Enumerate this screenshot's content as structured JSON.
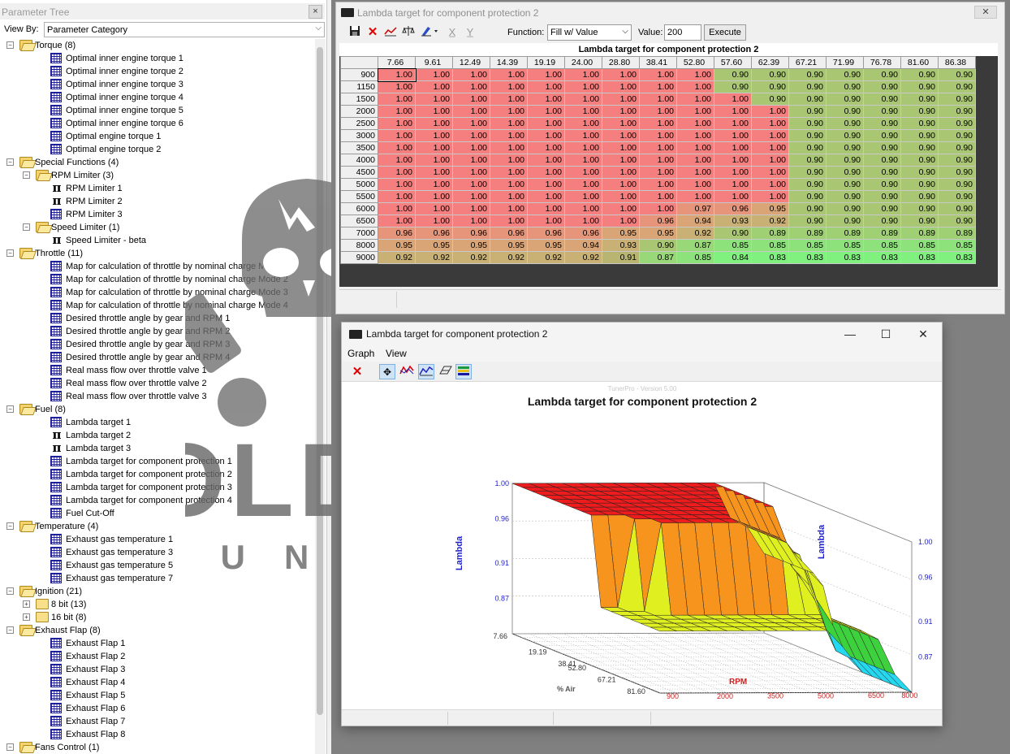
{
  "tree": {
    "title": "Parameter Tree",
    "close_icon": "×",
    "view_by_label": "View By:",
    "view_by_value": "Parameter Category",
    "rows": [
      {
        "kind": "folder-open",
        "level": 0,
        "label": "Torque (8)",
        "expander": "−"
      },
      {
        "kind": "table",
        "level": 1,
        "label": "Optimal inner engine torque 1"
      },
      {
        "kind": "table",
        "level": 1,
        "label": "Optimal inner engine torque 2"
      },
      {
        "kind": "table",
        "level": 1,
        "label": "Optimal inner engine torque 3"
      },
      {
        "kind": "table",
        "level": 1,
        "label": "Optimal inner engine torque 4"
      },
      {
        "kind": "table",
        "level": 1,
        "label": "Optimal inner engine torque 5"
      },
      {
        "kind": "table",
        "level": 1,
        "label": "Optimal inner engine torque 6"
      },
      {
        "kind": "table",
        "level": 1,
        "label": "Optimal engine torque 1"
      },
      {
        "kind": "table",
        "level": 1,
        "label": "Optimal engine torque 2"
      },
      {
        "kind": "folder-open",
        "level": 0,
        "label": "Special Functions (4)",
        "expander": "−"
      },
      {
        "kind": "folder-open",
        "level": 1,
        "label": "RPM Limiter (3)",
        "expander": "−"
      },
      {
        "kind": "pi",
        "level": 2,
        "label": "RPM Limiter 1"
      },
      {
        "kind": "pi",
        "level": 2,
        "label": "RPM Limiter 2"
      },
      {
        "kind": "table",
        "level": 2,
        "label": "RPM Limiter 3"
      },
      {
        "kind": "folder-open",
        "level": 1,
        "label": "Speed Limiter (1)",
        "expander": "−"
      },
      {
        "kind": "pi",
        "level": 2,
        "label": "Speed Limiter - beta"
      },
      {
        "kind": "folder-open",
        "level": 0,
        "label": "Throttle (11)",
        "expander": "−"
      },
      {
        "kind": "table",
        "level": 1,
        "label": "Map for calculation of throttle by nominal charge Mode 1"
      },
      {
        "kind": "table",
        "level": 1,
        "label": "Map for calculation of throttle by nominal charge Mode 2"
      },
      {
        "kind": "table",
        "level": 1,
        "label": "Map for calculation of throttle by nominal charge Mode 3"
      },
      {
        "kind": "table",
        "level": 1,
        "label": "Map for calculation of throttle by nominal charge Mode 4"
      },
      {
        "kind": "table",
        "level": 1,
        "label": "Desired throttle angle by gear and RPM 1"
      },
      {
        "kind": "table",
        "level": 1,
        "label": "Desired throttle angle by gear and RPM 2"
      },
      {
        "kind": "table",
        "level": 1,
        "label": "Desired throttle angle by gear and RPM 3"
      },
      {
        "kind": "table",
        "level": 1,
        "label": "Desired throttle angle by gear and RPM 4"
      },
      {
        "kind": "table",
        "level": 1,
        "label": "Real mass flow over throttle valve 1"
      },
      {
        "kind": "table",
        "level": 1,
        "label": "Real mass flow over throttle valve 2"
      },
      {
        "kind": "table",
        "level": 1,
        "label": "Real mass flow over throttle valve 3"
      },
      {
        "kind": "folder-open",
        "level": 0,
        "label": "Fuel (8)",
        "expander": "−"
      },
      {
        "kind": "table",
        "level": 1,
        "label": "Lambda target 1"
      },
      {
        "kind": "pi",
        "level": 1,
        "label": "Lambda target 2"
      },
      {
        "kind": "pi",
        "level": 1,
        "label": "Lambda target 3"
      },
      {
        "kind": "table",
        "level": 1,
        "label": "Lambda target for component protection 1"
      },
      {
        "kind": "table",
        "level": 1,
        "label": "Lambda target for component protection 2"
      },
      {
        "kind": "table",
        "level": 1,
        "label": "Lambda target for component protection 3"
      },
      {
        "kind": "table",
        "level": 1,
        "label": "Lambda target for component protection 4"
      },
      {
        "kind": "table",
        "level": 1,
        "label": "Fuel Cut-Off"
      },
      {
        "kind": "folder-open",
        "level": 0,
        "label": "Temperature (4)",
        "expander": "−"
      },
      {
        "kind": "table",
        "level": 1,
        "label": "Exhaust gas temperature 1"
      },
      {
        "kind": "table",
        "level": 1,
        "label": "Exhaust gas temperature 3"
      },
      {
        "kind": "table",
        "level": 1,
        "label": "Exhaust gas temperature 5"
      },
      {
        "kind": "table",
        "level": 1,
        "label": "Exhaust gas temperature 7"
      },
      {
        "kind": "folder-open",
        "level": 0,
        "label": "Ignition (21)",
        "expander": "−"
      },
      {
        "kind": "folder",
        "level": 1,
        "label": "8 bit (13)",
        "expander": "+"
      },
      {
        "kind": "folder",
        "level": 1,
        "label": "16 bit (8)",
        "expander": "+"
      },
      {
        "kind": "folder-open",
        "level": 0,
        "label": "Exhaust Flap (8)",
        "expander": "−"
      },
      {
        "kind": "table",
        "level": 1,
        "label": "Exhaust Flap 1"
      },
      {
        "kind": "table",
        "level": 1,
        "label": "Exhaust Flap 2"
      },
      {
        "kind": "table",
        "level": 1,
        "label": "Exhaust Flap 3"
      },
      {
        "kind": "table",
        "level": 1,
        "label": "Exhaust Flap 4"
      },
      {
        "kind": "table",
        "level": 1,
        "label": "Exhaust Flap 5"
      },
      {
        "kind": "table",
        "level": 1,
        "label": "Exhaust Flap 6"
      },
      {
        "kind": "table",
        "level": 1,
        "label": "Exhaust Flap 7"
      },
      {
        "kind": "table",
        "level": 1,
        "label": "Exhaust Flap 8"
      },
      {
        "kind": "folder-open",
        "level": 0,
        "label": "Fans Control (1)",
        "expander": "−"
      }
    ]
  },
  "watermark": {
    "text": "OLDSKULL",
    "subtext": "TUNING"
  },
  "table_window": {
    "title": "Lambda target for component protection 2",
    "close_icon": "✕",
    "toolbar": {
      "function_label": "Function:",
      "function_value": "Fill w/ Value",
      "value_label": "Value:",
      "value_value": "200",
      "execute_label": "Execute",
      "icons": [
        "save-icon",
        "delete-icon",
        "graph-icon",
        "scale-icon",
        "pen-icon",
        "math-x-icon",
        "math-y-icon"
      ]
    },
    "grid_title": "Lambda target for component protection 2",
    "col_headers": [
      "7.66",
      "9.61",
      "12.49",
      "14.39",
      "19.19",
      "24.00",
      "28.80",
      "38.41",
      "52.80",
      "57.60",
      "62.39",
      "67.21",
      "71.99",
      "76.78",
      "81.60",
      "86.38"
    ],
    "row_headers": [
      "900",
      "1150",
      "1500",
      "2000",
      "2500",
      "3000",
      "3500",
      "4000",
      "4500",
      "5000",
      "5500",
      "6000",
      "6500",
      "7000",
      "8000",
      "9000"
    ],
    "cells": [
      [
        "1.00",
        "1.00",
        "1.00",
        "1.00",
        "1.00",
        "1.00",
        "1.00",
        "1.00",
        "1.00",
        "0.90",
        "0.90",
        "0.90",
        "0.90",
        "0.90",
        "0.90",
        "0.90"
      ],
      [
        "1.00",
        "1.00",
        "1.00",
        "1.00",
        "1.00",
        "1.00",
        "1.00",
        "1.00",
        "1.00",
        "0.90",
        "0.90",
        "0.90",
        "0.90",
        "0.90",
        "0.90",
        "0.90"
      ],
      [
        "1.00",
        "1.00",
        "1.00",
        "1.00",
        "1.00",
        "1.00",
        "1.00",
        "1.00",
        "1.00",
        "1.00",
        "0.90",
        "0.90",
        "0.90",
        "0.90",
        "0.90",
        "0.90"
      ],
      [
        "1.00",
        "1.00",
        "1.00",
        "1.00",
        "1.00",
        "1.00",
        "1.00",
        "1.00",
        "1.00",
        "1.00",
        "1.00",
        "0.90",
        "0.90",
        "0.90",
        "0.90",
        "0.90"
      ],
      [
        "1.00",
        "1.00",
        "1.00",
        "1.00",
        "1.00",
        "1.00",
        "1.00",
        "1.00",
        "1.00",
        "1.00",
        "1.00",
        "0.90",
        "0.90",
        "0.90",
        "0.90",
        "0.90"
      ],
      [
        "1.00",
        "1.00",
        "1.00",
        "1.00",
        "1.00",
        "1.00",
        "1.00",
        "1.00",
        "1.00",
        "1.00",
        "1.00",
        "0.90",
        "0.90",
        "0.90",
        "0.90",
        "0.90"
      ],
      [
        "1.00",
        "1.00",
        "1.00",
        "1.00",
        "1.00",
        "1.00",
        "1.00",
        "1.00",
        "1.00",
        "1.00",
        "1.00",
        "0.90",
        "0.90",
        "0.90",
        "0.90",
        "0.90"
      ],
      [
        "1.00",
        "1.00",
        "1.00",
        "1.00",
        "1.00",
        "1.00",
        "1.00",
        "1.00",
        "1.00",
        "1.00",
        "1.00",
        "0.90",
        "0.90",
        "0.90",
        "0.90",
        "0.90"
      ],
      [
        "1.00",
        "1.00",
        "1.00",
        "1.00",
        "1.00",
        "1.00",
        "1.00",
        "1.00",
        "1.00",
        "1.00",
        "1.00",
        "0.90",
        "0.90",
        "0.90",
        "0.90",
        "0.90"
      ],
      [
        "1.00",
        "1.00",
        "1.00",
        "1.00",
        "1.00",
        "1.00",
        "1.00",
        "1.00",
        "1.00",
        "1.00",
        "1.00",
        "0.90",
        "0.90",
        "0.90",
        "0.90",
        "0.90"
      ],
      [
        "1.00",
        "1.00",
        "1.00",
        "1.00",
        "1.00",
        "1.00",
        "1.00",
        "1.00",
        "1.00",
        "1.00",
        "1.00",
        "0.90",
        "0.90",
        "0.90",
        "0.90",
        "0.90"
      ],
      [
        "1.00",
        "1.00",
        "1.00",
        "1.00",
        "1.00",
        "1.00",
        "1.00",
        "1.00",
        "0.97",
        "0.96",
        "0.95",
        "0.90",
        "0.90",
        "0.90",
        "0.90",
        "0.90"
      ],
      [
        "1.00",
        "1.00",
        "1.00",
        "1.00",
        "1.00",
        "1.00",
        "1.00",
        "0.96",
        "0.94",
        "0.93",
        "0.92",
        "0.90",
        "0.90",
        "0.90",
        "0.90",
        "0.90"
      ],
      [
        "0.96",
        "0.96",
        "0.96",
        "0.96",
        "0.96",
        "0.96",
        "0.95",
        "0.95",
        "0.92",
        "0.90",
        "0.89",
        "0.89",
        "0.89",
        "0.89",
        "0.89",
        "0.89"
      ],
      [
        "0.95",
        "0.95",
        "0.95",
        "0.95",
        "0.95",
        "0.94",
        "0.93",
        "0.90",
        "0.87",
        "0.85",
        "0.85",
        "0.85",
        "0.85",
        "0.85",
        "0.85",
        "0.85"
      ],
      [
        "0.92",
        "0.92",
        "0.92",
        "0.92",
        "0.92",
        "0.92",
        "0.91",
        "0.87",
        "0.85",
        "0.84",
        "0.83",
        "0.83",
        "0.83",
        "0.83",
        "0.83",
        "0.83"
      ]
    ]
  },
  "graph_window": {
    "title": "Lambda target for component protection 2",
    "menu": [
      "Graph",
      "View"
    ],
    "window_controls": {
      "minimize": "—",
      "maximize": "☐",
      "close": "✕"
    },
    "toolbar_icons": [
      "close-x-icon",
      "move-icon",
      "rotate-icon",
      "surface-icon",
      "wireframe-icon",
      "legend-icon"
    ]
  },
  "chart_data": {
    "type": "surface3d",
    "version_text": "TunerPro - Version 5.00",
    "title": "Lambda target for component protection 2",
    "zlabel_left": "Lambda",
    "zlabel_right": "Lambda",
    "z_ticks": [
      "1.00",
      "0.96",
      "0.91",
      "0.87"
    ],
    "x_axis_label": "% Air",
    "x_ticks": [
      "7.66",
      "19.19",
      "38.41",
      "52.80",
      "67.21",
      "81.60"
    ],
    "y_axis_label": "RPM",
    "y_ticks": [
      "900",
      "2000",
      "3500",
      "5000",
      "6500",
      "8000"
    ],
    "zlim": [
      0.83,
      1.0
    ],
    "colors": {
      "red": "#ee1c1c",
      "orange": "#f7941d",
      "yellow": "#dfef1f",
      "green": "#3ed13e",
      "cyan": "#25d8f0",
      "blue": "#2222ee"
    }
  }
}
